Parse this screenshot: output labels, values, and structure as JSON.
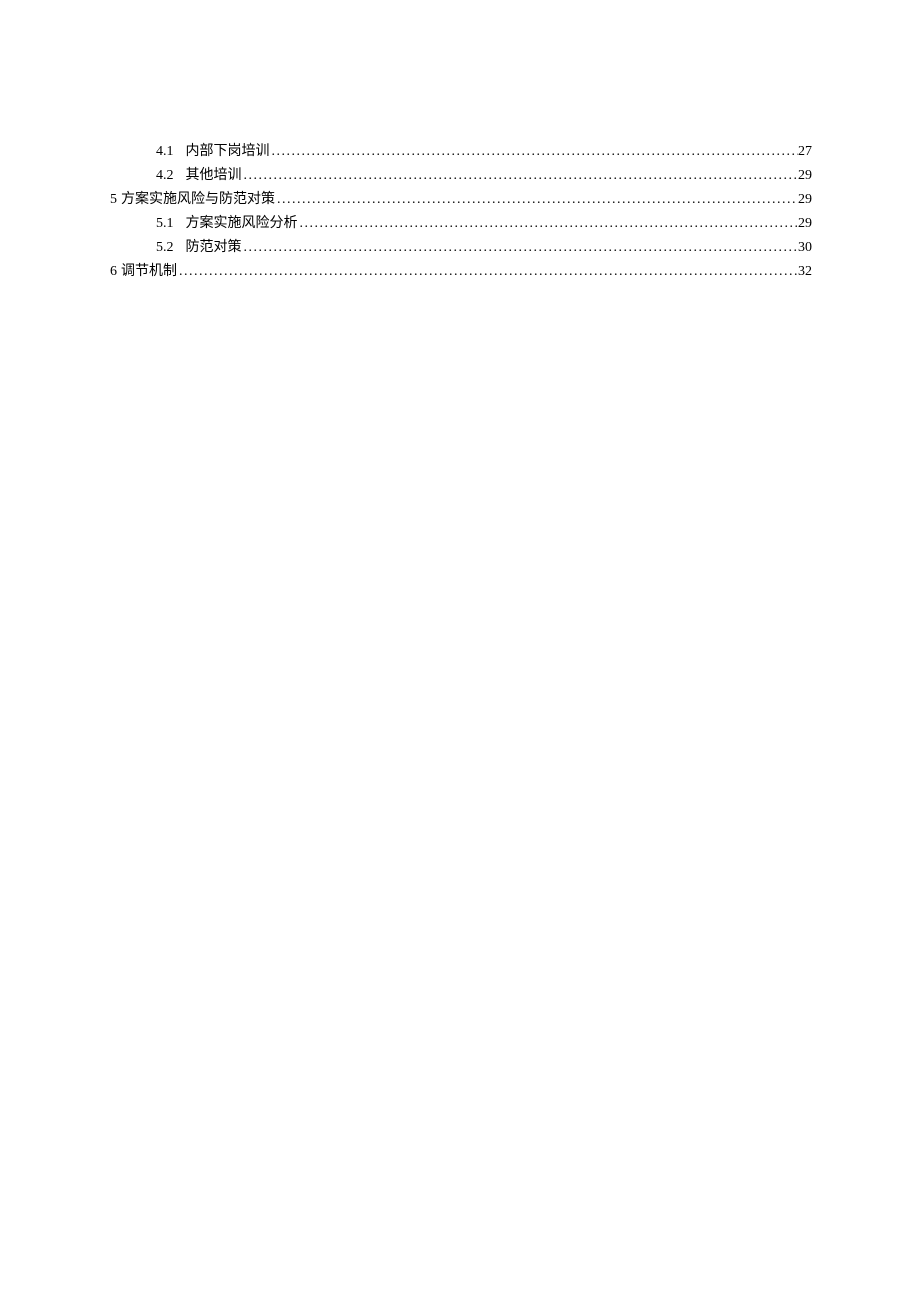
{
  "toc": {
    "items": [
      {
        "level": 2,
        "num": "4.1",
        "title": "内部下岗培训",
        "page": "27"
      },
      {
        "level": 2,
        "num": "4.2",
        "title": "其他培训",
        "page": "29"
      },
      {
        "level": 1,
        "num": "5",
        "title": "方案实施风险与防范对策",
        "page": "29"
      },
      {
        "level": 2,
        "num": "5.1",
        "title": "方案实施风险分析",
        "page": "29"
      },
      {
        "level": 2,
        "num": "5.2",
        "title": "防范对策",
        "page": "30"
      },
      {
        "level": 1,
        "num": "6",
        "title": "调节机制",
        "page": "32"
      }
    ]
  }
}
